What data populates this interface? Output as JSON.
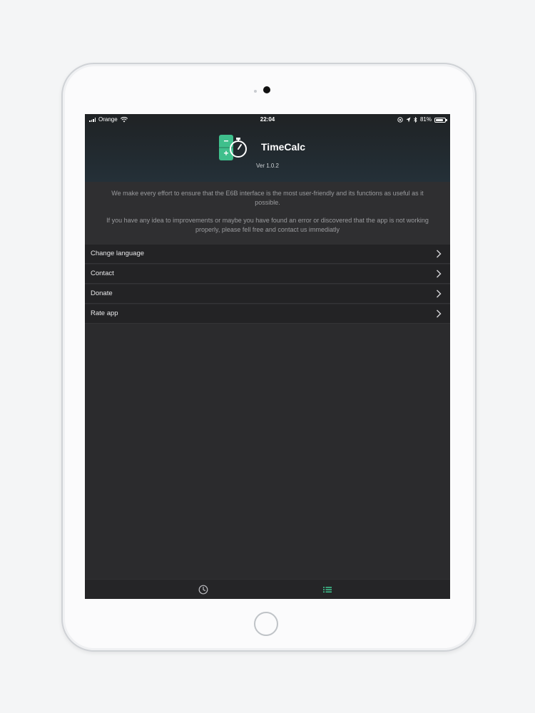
{
  "status_bar": {
    "carrier": "Orange",
    "time": "22:04",
    "battery": "81%",
    "battery_level": 0.81
  },
  "app": {
    "title": "TimeCalc",
    "version": "Ver 1.0.2",
    "accent_color": "#3fbf8c"
  },
  "about": {
    "paragraph_1": "We make every effort to ensure that the E6B interface is the most user-friendly and its functions as useful as it possible.",
    "paragraph_2": "If you have any idea to improvements or maybe you have found an error or discovered that the app is not working properly, please fell free and contact us immediatly"
  },
  "menu": {
    "items": [
      {
        "label": "Change language"
      },
      {
        "label": "Contact"
      },
      {
        "label": "Donate"
      },
      {
        "label": "Rate app"
      }
    ]
  },
  "tabs": [
    {
      "icon": "clock-icon",
      "active": false
    },
    {
      "icon": "list-icon",
      "active": true
    }
  ]
}
